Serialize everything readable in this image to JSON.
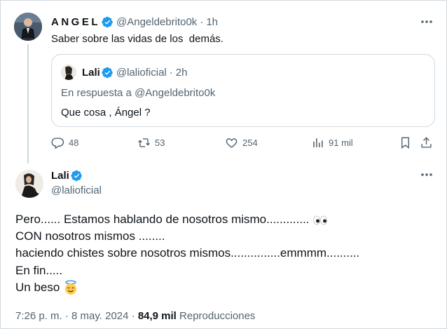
{
  "colors": {
    "verified_blue": "#1d9bf0",
    "text_primary": "#0f1419",
    "text_secondary": "#536471",
    "border": "#cfd9de"
  },
  "reply_tweet": {
    "display_name": "ANGEL",
    "handle": "@Angeldebrito0k",
    "separator": "·",
    "time": "1h",
    "text": "Saber sobre las vidas de los  demás.",
    "quoted_tweet": {
      "display_name": "Lali",
      "handle": "@lalioficial",
      "separator": "·",
      "time": "2h",
      "reply_context": "En respuesta a @Angeldebrito0k",
      "text": "Que cosa , Ángel ?"
    },
    "actions": {
      "replies": "48",
      "retweets": "53",
      "likes": "254",
      "views": "91 mil"
    },
    "icons": [
      "reply-icon",
      "retweet-icon",
      "like-icon",
      "views-icon",
      "bookmark-icon",
      "share-icon",
      "more-icon",
      "verified-icon"
    ]
  },
  "main_tweet": {
    "display_name": "Lali",
    "handle": "@lalioficial",
    "lines": [
      "Pero...... Estamos hablando de nosotros mismo.............",
      "CON nosotros mismos ........",
      "haciendo chistes sobre nosotros mismos...............emmmm..........",
      "En fin.....",
      "Un beso"
    ],
    "emojis": [
      "eyes-emoji",
      "smiling-face-with-halo-emoji"
    ],
    "timestamp": "7:26 p. m. · 8 may. 2024 · ",
    "views_count": "84,9 mil",
    "views_label": " Reproducciones"
  }
}
